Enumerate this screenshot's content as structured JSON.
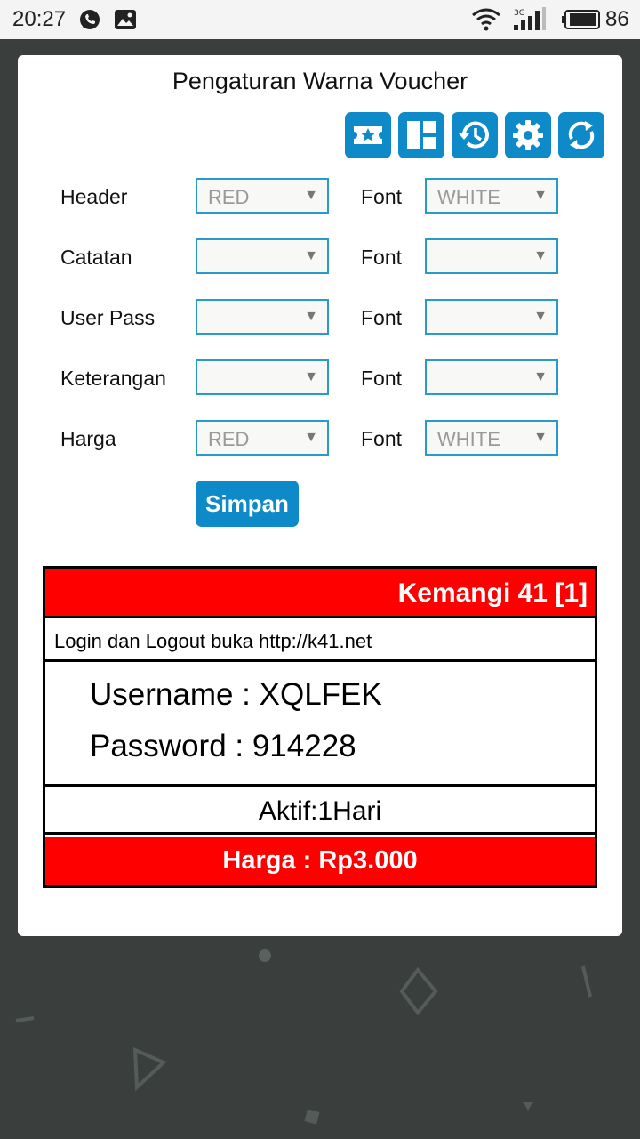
{
  "status_bar": {
    "time": "20:27",
    "battery": "86",
    "icons": [
      "whatsapp-icon",
      "gallery-icon",
      "wifi-icon",
      "signal-3g-icon",
      "battery-icon"
    ]
  },
  "page": {
    "title": "Pengaturan Warna Voucher"
  },
  "toolbar": {
    "buttons": [
      "ticket-star-icon",
      "dashboard-icon",
      "history-icon",
      "settings-icon",
      "refresh-icon"
    ]
  },
  "form": {
    "rows": [
      {
        "label": "Header",
        "bg_value": "RED",
        "font_label": "Font",
        "font_value": "WHITE"
      },
      {
        "label": "Catatan",
        "bg_value": "",
        "font_label": "Font",
        "font_value": ""
      },
      {
        "label": "User Pass",
        "bg_value": "",
        "font_label": "Font",
        "font_value": ""
      },
      {
        "label": "Keterangan",
        "bg_value": "",
        "font_label": "Font",
        "font_value": ""
      },
      {
        "label": "Harga",
        "bg_value": "RED",
        "font_label": "Font",
        "font_value": "WHITE"
      }
    ],
    "save_label": "Simpan"
  },
  "voucher": {
    "header": "Kemangi 41 [1]",
    "note": "Login dan Logout buka http://k41.net",
    "username": "Username : XQLFEK",
    "password": "Password : 914228",
    "active": "Aktif:1Hari",
    "price": "Harga : Rp3.000"
  },
  "colors": {
    "accent": "#0d8ac7",
    "voucher_red": "#ff0000",
    "background": "#3a3f3e"
  }
}
